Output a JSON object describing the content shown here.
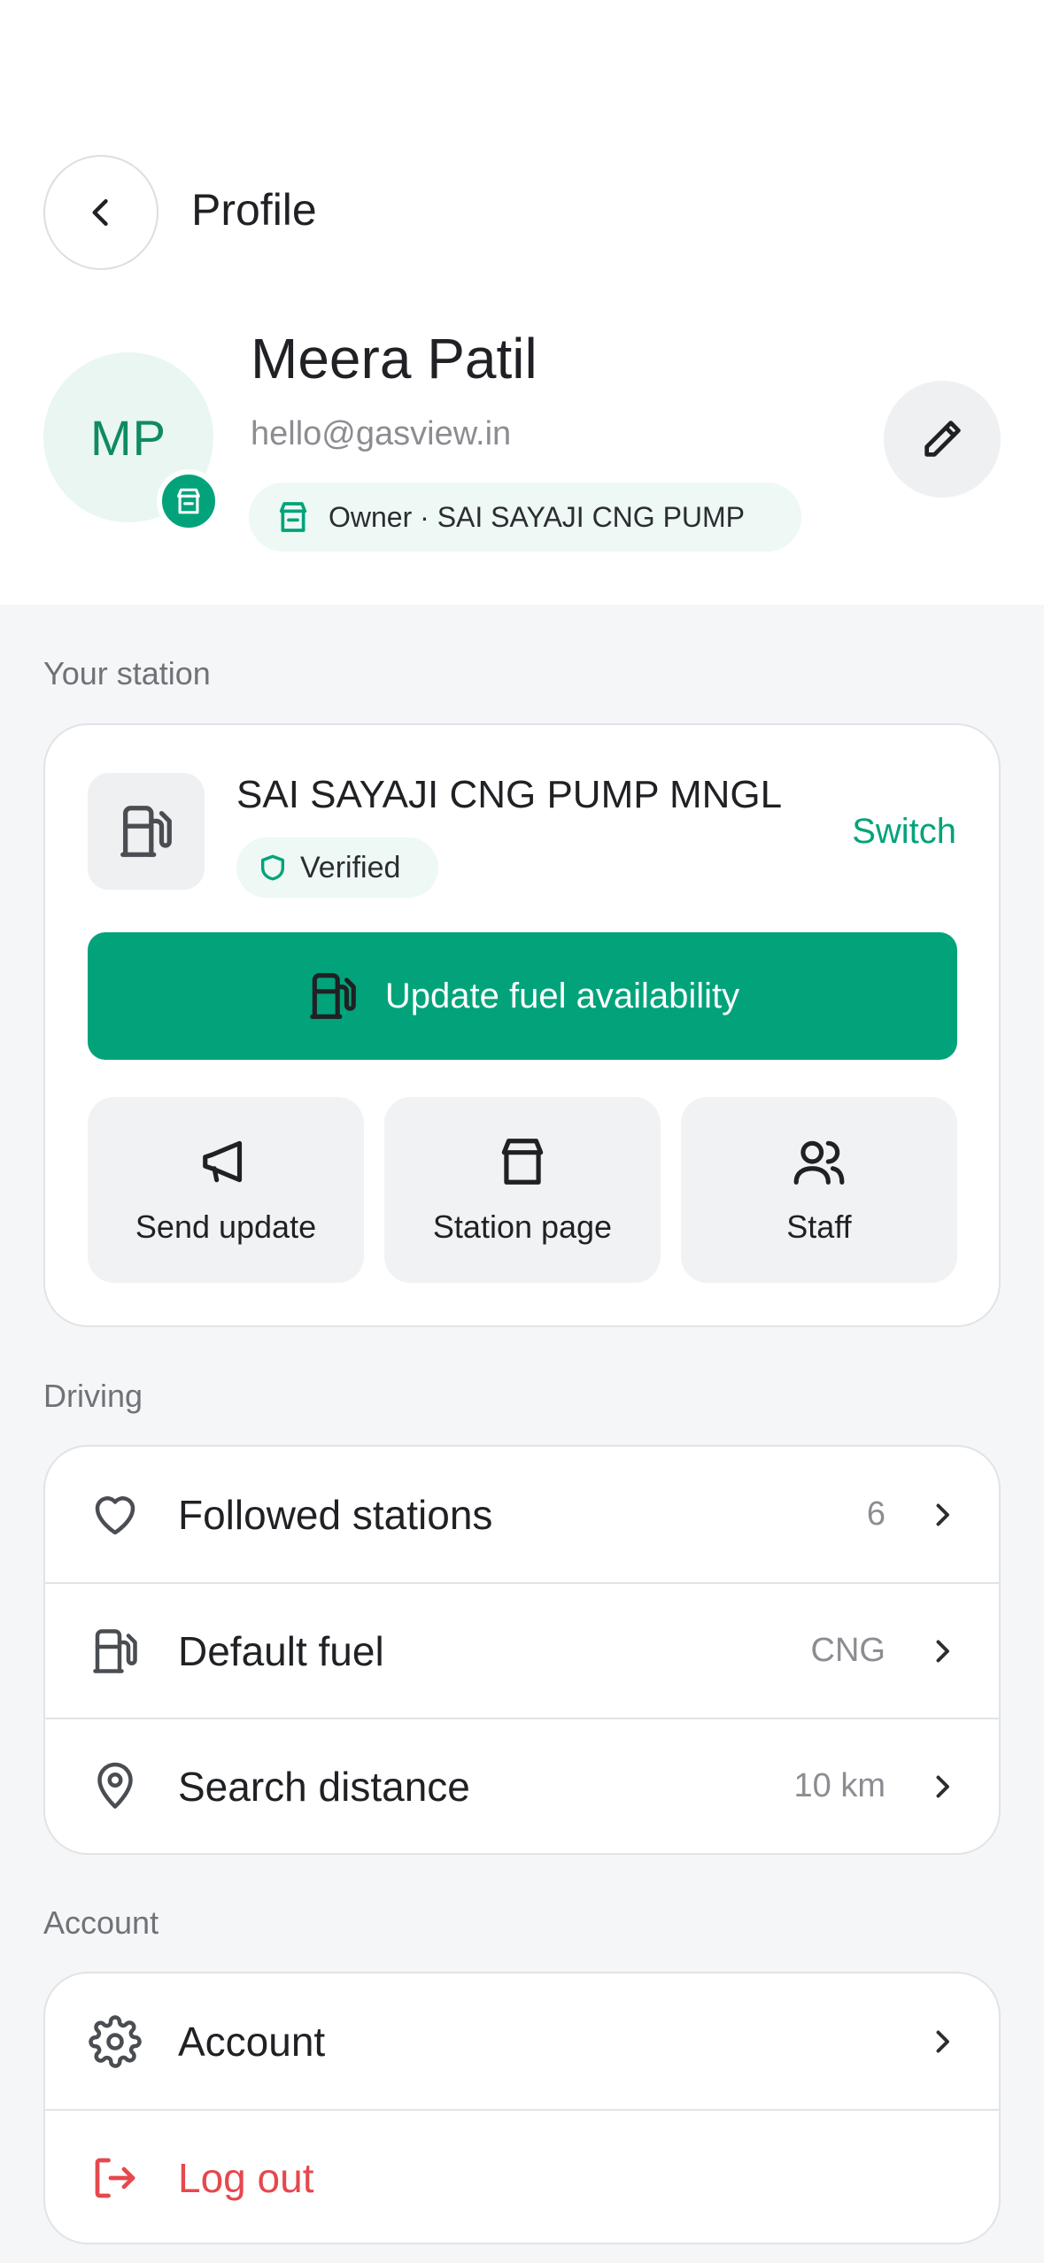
{
  "header": {
    "title": "Profile"
  },
  "profile": {
    "initials": "MP",
    "name": "Meera Patil",
    "email": "hello@gasview.in",
    "role_chip": "Owner · SAI SAYAJI CNG PUMP"
  },
  "station_section": {
    "label": "Your station",
    "station_name": "SAI SAYAJI CNG PUMP MNGL",
    "verified_label": "Verified",
    "switch_label": "Switch",
    "update_button": "Update fuel availability",
    "actions": [
      {
        "label": "Send update",
        "icon": "megaphone-icon"
      },
      {
        "label": "Station page",
        "icon": "storefront-icon"
      },
      {
        "label": "Staff",
        "icon": "users-icon"
      }
    ]
  },
  "driving_section": {
    "label": "Driving",
    "rows": [
      {
        "label": "Followed stations",
        "value": "6",
        "icon": "heart-icon"
      },
      {
        "label": "Default fuel",
        "value": "CNG",
        "icon": "fuel-pump-icon"
      },
      {
        "label": "Search distance",
        "value": "10 km",
        "icon": "map-pin-icon"
      }
    ]
  },
  "account_section": {
    "label": "Account",
    "rows": [
      {
        "label": "Account",
        "icon": "gear-icon"
      },
      {
        "label": "Log out",
        "icon": "logout-icon"
      }
    ]
  },
  "colors": {
    "accent": "#02a37a",
    "danger": "#e5484d",
    "background": "#f5f6f8"
  }
}
